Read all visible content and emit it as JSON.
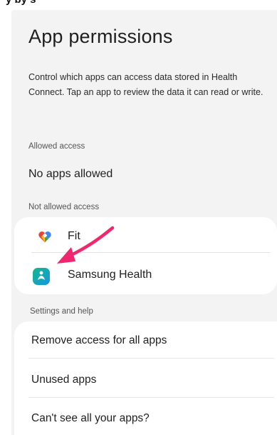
{
  "page": {
    "title": "App permissions",
    "description": "Control which apps can access data stored in Health Connect. Tap an app to review the data it can read or write."
  },
  "allowed": {
    "label": "Allowed access",
    "empty_text": "No apps allowed"
  },
  "not_allowed": {
    "label": "Not allowed access",
    "apps": [
      {
        "name": "Fit",
        "icon": "google-fit-heart-icon"
      },
      {
        "name": "Samsung Health",
        "icon": "samsung-health-icon"
      }
    ]
  },
  "settings": {
    "label": "Settings and help",
    "items": [
      {
        "label": "Remove access for all apps"
      },
      {
        "label": "Unused apps"
      },
      {
        "label": "Can't see all your apps?"
      }
    ]
  },
  "colors": {
    "background": "#f3f3f3",
    "card": "#ffffff",
    "annotation_arrow": "#f0266e",
    "samsung_green": "#14b88a",
    "samsung_blue": "#1597e5"
  }
}
